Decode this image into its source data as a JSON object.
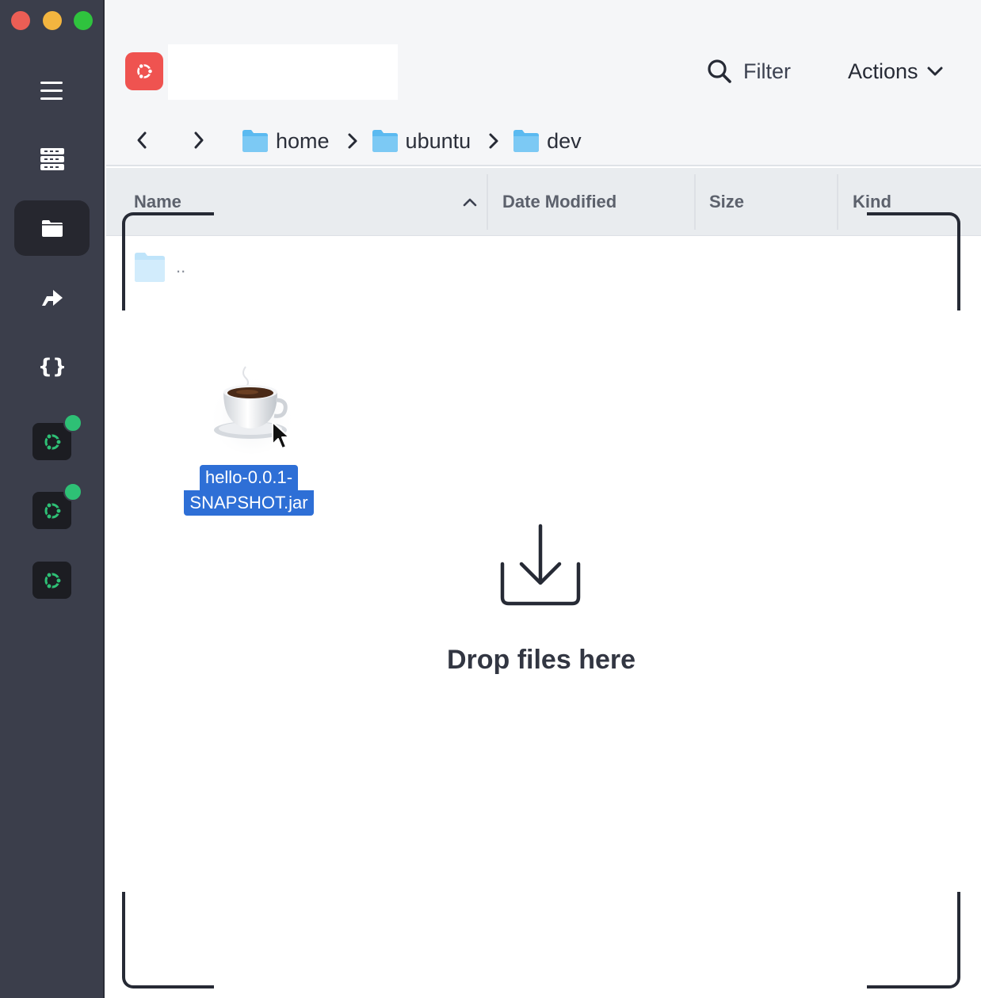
{
  "window": {
    "traffic_lights": [
      "close",
      "minimize",
      "zoom"
    ]
  },
  "sidebar": {
    "items": [
      {
        "name": "menu-icon"
      },
      {
        "name": "hosts-icon"
      },
      {
        "name": "sftp-folder-icon",
        "active": true
      },
      {
        "name": "port-forwarding-icon"
      },
      {
        "name": "snippets-icon"
      }
    ],
    "hosts": [
      {
        "name": "ubuntu-host-icon",
        "connected": true
      },
      {
        "name": "ubuntu-host-icon",
        "connected": true
      },
      {
        "name": "ubuntu-host-icon",
        "connected": false
      }
    ],
    "colors": {
      "background": "#3b3e4b",
      "active": "#26272f",
      "online": "#2ec075",
      "ubuntu": "#2ec075"
    }
  },
  "toolbar": {
    "title_value": "",
    "filter_label": "Filter",
    "actions_label": "Actions"
  },
  "breadcrumb": [
    {
      "label": "home"
    },
    {
      "label": "ubuntu"
    },
    {
      "label": "dev"
    }
  ],
  "columns": {
    "name": "Name",
    "date_modified": "Date Modified",
    "size": "Size",
    "kind": "Kind",
    "sort": "ascending"
  },
  "rows": [
    {
      "name": ".."
    }
  ],
  "drag": {
    "file_line1": "hello-0.0.1-",
    "file_line2": "SNAPSHOT.jar",
    "icon": "java-coffee-cup-icon"
  },
  "dropzone": {
    "text": "Drop files here"
  }
}
